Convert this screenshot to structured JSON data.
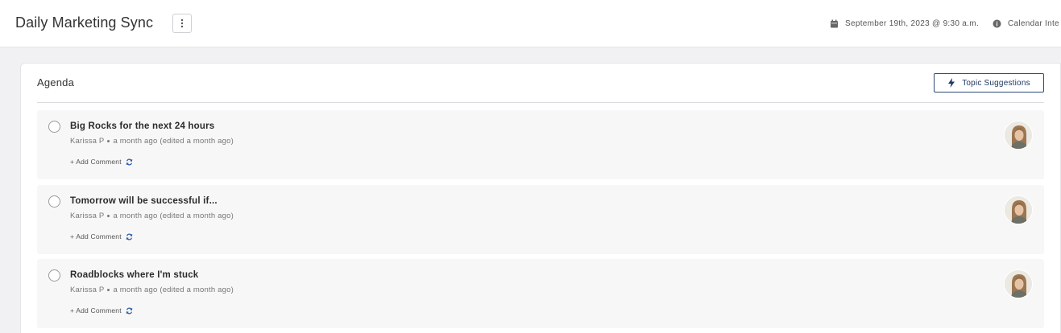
{
  "header": {
    "title": "Daily Marketing Sync",
    "more_icon": "kebab-vertical-icon",
    "datetime": "September 19th, 2023 @ 9:30 a.m.",
    "calendar_label": "Calendar Inte"
  },
  "agenda": {
    "title": "Agenda",
    "topic_suggestions_label": "Topic Suggestions",
    "items": [
      {
        "title": "Big Rocks for the next 24 hours",
        "author": "Karissa P",
        "time": "a month ago (edited a month ago)",
        "add_comment": "+ Add Comment"
      },
      {
        "title": "Tomorrow will be successful if...",
        "author": "Karissa P",
        "time": "a month ago (edited a month ago)",
        "add_comment": "+ Add Comment"
      },
      {
        "title": "Roadblocks where I'm stuck",
        "author": "Karissa P",
        "time": "a month ago (edited a month ago)",
        "add_comment": "+ Add Comment"
      }
    ]
  },
  "colors": {
    "accent": "#1f3763",
    "item_bg": "#f7f7f7",
    "page_bg": "#f1f1f3"
  }
}
